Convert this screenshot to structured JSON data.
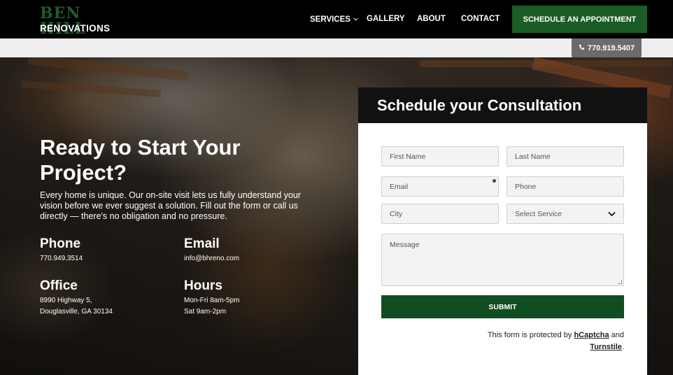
{
  "header": {
    "logo_top": "BEN HILL",
    "logo_bottom": "RENOVATIONS",
    "nav": {
      "services": "SERVICES",
      "gallery": "GALLERY",
      "about": "ABOUT",
      "contact": "CONTACT"
    },
    "cta_label": "SCHEDULE AN APPOINTMENT",
    "phone_tab": "770.919.5407",
    "colors": {
      "brand_green": "#1c5c26",
      "nav_bg": "#000000"
    }
  },
  "hero": {
    "title": "Ready to Start Your Project?",
    "description": "Every home is unique. Our on-site visit lets us fully understand your vision before we ever suggest a solution. Fill out the form or call us directly — there's no obligation and no pressure.",
    "phone": {
      "heading": "Phone",
      "value": "770.949.3514"
    },
    "email": {
      "heading": "Email",
      "value": "info@bhreno.com"
    },
    "office": {
      "heading": "Office",
      "line1": "8990 Highway 5,",
      "line2": "Douglasville, GA 30134"
    },
    "hours": {
      "heading": "Hours",
      "line1": "Mon-Fri 8am-5pm",
      "line2": "Sat 9am-2pm"
    }
  },
  "form": {
    "title": "Schedule your Consultation",
    "first_name": "First Name",
    "last_name": "Last Name",
    "email": "Email",
    "phone": "Phone",
    "city": "City",
    "service": "Select Service",
    "message": "Message",
    "submit": "SUBMIT",
    "captcha_prefix": "This form is protected by",
    "captcha_link1": "hCaptcha",
    "captcha_and": "and",
    "captcha_link2": "Turnstile",
    "captcha_end": "."
  }
}
